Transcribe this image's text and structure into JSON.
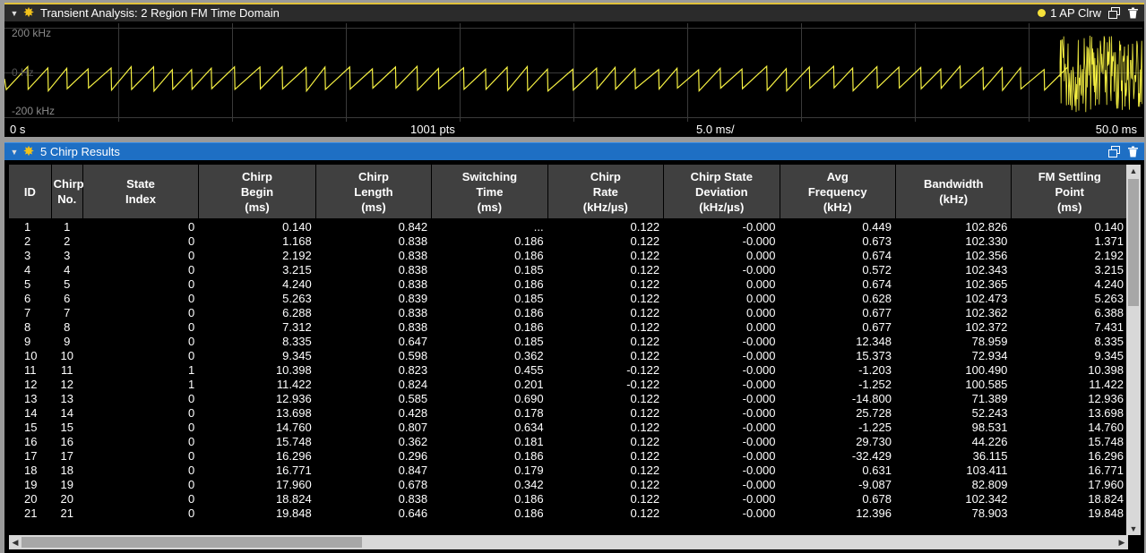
{
  "analysis_window": {
    "title": "Transient Analysis: 2 Region FM Time Domain",
    "indicator": "1 AP Clrw",
    "y_top": "200 kHz",
    "y_mid": "0 Hz",
    "y_bottom": "-200 kHz",
    "x_start": "0 s",
    "points": "1001 pts",
    "x_div": "5.0 ms/",
    "x_end": "50.0 ms",
    "trace_color": "#f5f042",
    "grid_color": "#3a3a3a"
  },
  "results_window": {
    "title": "5 Chirp Results",
    "columns": [
      "ID",
      "Chirp\nNo.",
      "State\nIndex",
      "Chirp\nBegin\n(ms)",
      "Chirp\nLength\n(ms)",
      "Switching\nTime\n(ms)",
      "Chirp\nRate\n(kHz/µs)",
      "Chirp State\nDeviation\n(kHz/µs)",
      "Avg\nFrequency\n(kHz)",
      "Bandwidth\n(kHz)",
      "FM Settling\nPoint\n(ms)"
    ],
    "rows": [
      [
        "1",
        "1",
        "0",
        "0.140",
        "0.842",
        "...",
        "0.122",
        "-0.000",
        "0.449",
        "102.826",
        "0.140"
      ],
      [
        "2",
        "2",
        "0",
        "1.168",
        "0.838",
        "0.186",
        "0.122",
        "-0.000",
        "0.673",
        "102.330",
        "1.371"
      ],
      [
        "3",
        "3",
        "0",
        "2.192",
        "0.838",
        "0.186",
        "0.122",
        "0.000",
        "0.674",
        "102.356",
        "2.192"
      ],
      [
        "4",
        "4",
        "0",
        "3.215",
        "0.838",
        "0.185",
        "0.122",
        "-0.000",
        "0.572",
        "102.343",
        "3.215"
      ],
      [
        "5",
        "5",
        "0",
        "4.240",
        "0.838",
        "0.186",
        "0.122",
        "0.000",
        "0.674",
        "102.365",
        "4.240"
      ],
      [
        "6",
        "6",
        "0",
        "5.263",
        "0.839",
        "0.185",
        "0.122",
        "0.000",
        "0.628",
        "102.473",
        "5.263"
      ],
      [
        "7",
        "7",
        "0",
        "6.288",
        "0.838",
        "0.186",
        "0.122",
        "0.000",
        "0.677",
        "102.362",
        "6.388"
      ],
      [
        "8",
        "8",
        "0",
        "7.312",
        "0.838",
        "0.186",
        "0.122",
        "0.000",
        "0.677",
        "102.372",
        "7.431"
      ],
      [
        "9",
        "9",
        "0",
        "8.335",
        "0.647",
        "0.185",
        "0.122",
        "-0.000",
        "12.348",
        "78.959",
        "8.335"
      ],
      [
        "10",
        "10",
        "0",
        "9.345",
        "0.598",
        "0.362",
        "0.122",
        "-0.000",
        "15.373",
        "72.934",
        "9.345"
      ],
      [
        "11",
        "11",
        "1",
        "10.398",
        "0.823",
        "0.455",
        "-0.122",
        "-0.000",
        "-1.203",
        "100.490",
        "10.398"
      ],
      [
        "12",
        "12",
        "1",
        "11.422",
        "0.824",
        "0.201",
        "-0.122",
        "-0.000",
        "-1.252",
        "100.585",
        "11.422"
      ],
      [
        "13",
        "13",
        "0",
        "12.936",
        "0.585",
        "0.690",
        "0.122",
        "-0.000",
        "-14.800",
        "71.389",
        "12.936"
      ],
      [
        "14",
        "14",
        "0",
        "13.698",
        "0.428",
        "0.178",
        "0.122",
        "-0.000",
        "25.728",
        "52.243",
        "13.698"
      ],
      [
        "15",
        "15",
        "0",
        "14.760",
        "0.807",
        "0.634",
        "0.122",
        "-0.000",
        "-1.225",
        "98.531",
        "14.760"
      ],
      [
        "16",
        "16",
        "0",
        "15.748",
        "0.362",
        "0.181",
        "0.122",
        "-0.000",
        "29.730",
        "44.226",
        "15.748"
      ],
      [
        "17",
        "17",
        "0",
        "16.296",
        "0.296",
        "0.186",
        "0.122",
        "-0.000",
        "-32.429",
        "36.115",
        "16.296"
      ],
      [
        "18",
        "18",
        "0",
        "16.771",
        "0.847",
        "0.179",
        "0.122",
        "-0.000",
        "0.631",
        "103.411",
        "16.771"
      ],
      [
        "19",
        "19",
        "0",
        "17.960",
        "0.678",
        "0.342",
        "0.122",
        "-0.000",
        "-9.087",
        "82.809",
        "17.960"
      ],
      [
        "20",
        "20",
        "0",
        "18.824",
        "0.838",
        "0.186",
        "0.122",
        "-0.000",
        "0.678",
        "102.342",
        "18.824"
      ],
      [
        "21",
        "21",
        "0",
        "19.848",
        "0.646",
        "0.186",
        "0.122",
        "-0.000",
        "12.396",
        "78.903",
        "19.848"
      ]
    ]
  }
}
